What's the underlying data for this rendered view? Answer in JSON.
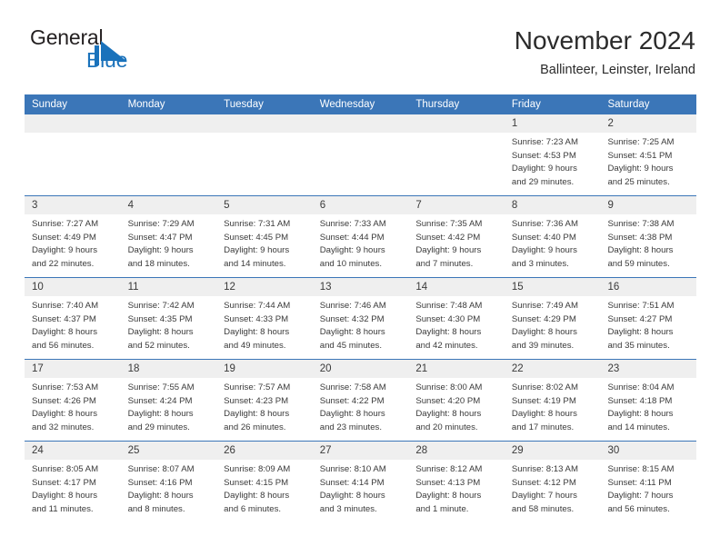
{
  "brand": {
    "name_top": "General",
    "name_bottom": "Blue",
    "logo_icon": "triangle-logo-icon",
    "accent_color": "#1a72bb"
  },
  "header": {
    "title": "November 2024",
    "subtitle": "Ballinteer, Leinster, Ireland"
  },
  "theme": {
    "header_blue": "#3b76b8",
    "cell_head_gray": "#efefef",
    "text_color": "#3a3a3a"
  },
  "calendar": {
    "weekday_headers": [
      "Sunday",
      "Monday",
      "Tuesday",
      "Wednesday",
      "Thursday",
      "Friday",
      "Saturday"
    ],
    "weeks": [
      [
        {
          "day": "",
          "lines": [],
          "empty": true
        },
        {
          "day": "",
          "lines": [],
          "empty": true
        },
        {
          "day": "",
          "lines": [],
          "empty": true
        },
        {
          "day": "",
          "lines": [],
          "empty": true
        },
        {
          "day": "",
          "lines": [],
          "empty": true
        },
        {
          "day": "1",
          "lines": [
            "Sunrise: 7:23 AM",
            "Sunset: 4:53 PM",
            "Daylight: 9 hours",
            "and 29 minutes."
          ],
          "empty": false
        },
        {
          "day": "2",
          "lines": [
            "Sunrise: 7:25 AM",
            "Sunset: 4:51 PM",
            "Daylight: 9 hours",
            "and 25 minutes."
          ],
          "empty": false
        }
      ],
      [
        {
          "day": "3",
          "lines": [
            "Sunrise: 7:27 AM",
            "Sunset: 4:49 PM",
            "Daylight: 9 hours",
            "and 22 minutes."
          ],
          "empty": false
        },
        {
          "day": "4",
          "lines": [
            "Sunrise: 7:29 AM",
            "Sunset: 4:47 PM",
            "Daylight: 9 hours",
            "and 18 minutes."
          ],
          "empty": false
        },
        {
          "day": "5",
          "lines": [
            "Sunrise: 7:31 AM",
            "Sunset: 4:45 PM",
            "Daylight: 9 hours",
            "and 14 minutes."
          ],
          "empty": false
        },
        {
          "day": "6",
          "lines": [
            "Sunrise: 7:33 AM",
            "Sunset: 4:44 PM",
            "Daylight: 9 hours",
            "and 10 minutes."
          ],
          "empty": false
        },
        {
          "day": "7",
          "lines": [
            "Sunrise: 7:35 AM",
            "Sunset: 4:42 PM",
            "Daylight: 9 hours",
            "and 7 minutes."
          ],
          "empty": false
        },
        {
          "day": "8",
          "lines": [
            "Sunrise: 7:36 AM",
            "Sunset: 4:40 PM",
            "Daylight: 9 hours",
            "and 3 minutes."
          ],
          "empty": false
        },
        {
          "day": "9",
          "lines": [
            "Sunrise: 7:38 AM",
            "Sunset: 4:38 PM",
            "Daylight: 8 hours",
            "and 59 minutes."
          ],
          "empty": false
        }
      ],
      [
        {
          "day": "10",
          "lines": [
            "Sunrise: 7:40 AM",
            "Sunset: 4:37 PM",
            "Daylight: 8 hours",
            "and 56 minutes."
          ],
          "empty": false
        },
        {
          "day": "11",
          "lines": [
            "Sunrise: 7:42 AM",
            "Sunset: 4:35 PM",
            "Daylight: 8 hours",
            "and 52 minutes."
          ],
          "empty": false
        },
        {
          "day": "12",
          "lines": [
            "Sunrise: 7:44 AM",
            "Sunset: 4:33 PM",
            "Daylight: 8 hours",
            "and 49 minutes."
          ],
          "empty": false
        },
        {
          "day": "13",
          "lines": [
            "Sunrise: 7:46 AM",
            "Sunset: 4:32 PM",
            "Daylight: 8 hours",
            "and 45 minutes."
          ],
          "empty": false
        },
        {
          "day": "14",
          "lines": [
            "Sunrise: 7:48 AM",
            "Sunset: 4:30 PM",
            "Daylight: 8 hours",
            "and 42 minutes."
          ],
          "empty": false
        },
        {
          "day": "15",
          "lines": [
            "Sunrise: 7:49 AM",
            "Sunset: 4:29 PM",
            "Daylight: 8 hours",
            "and 39 minutes."
          ],
          "empty": false
        },
        {
          "day": "16",
          "lines": [
            "Sunrise: 7:51 AM",
            "Sunset: 4:27 PM",
            "Daylight: 8 hours",
            "and 35 minutes."
          ],
          "empty": false
        }
      ],
      [
        {
          "day": "17",
          "lines": [
            "Sunrise: 7:53 AM",
            "Sunset: 4:26 PM",
            "Daylight: 8 hours",
            "and 32 minutes."
          ],
          "empty": false
        },
        {
          "day": "18",
          "lines": [
            "Sunrise: 7:55 AM",
            "Sunset: 4:24 PM",
            "Daylight: 8 hours",
            "and 29 minutes."
          ],
          "empty": false
        },
        {
          "day": "19",
          "lines": [
            "Sunrise: 7:57 AM",
            "Sunset: 4:23 PM",
            "Daylight: 8 hours",
            "and 26 minutes."
          ],
          "empty": false
        },
        {
          "day": "20",
          "lines": [
            "Sunrise: 7:58 AM",
            "Sunset: 4:22 PM",
            "Daylight: 8 hours",
            "and 23 minutes."
          ],
          "empty": false
        },
        {
          "day": "21",
          "lines": [
            "Sunrise: 8:00 AM",
            "Sunset: 4:20 PM",
            "Daylight: 8 hours",
            "and 20 minutes."
          ],
          "empty": false
        },
        {
          "day": "22",
          "lines": [
            "Sunrise: 8:02 AM",
            "Sunset: 4:19 PM",
            "Daylight: 8 hours",
            "and 17 minutes."
          ],
          "empty": false
        },
        {
          "day": "23",
          "lines": [
            "Sunrise: 8:04 AM",
            "Sunset: 4:18 PM",
            "Daylight: 8 hours",
            "and 14 minutes."
          ],
          "empty": false
        }
      ],
      [
        {
          "day": "24",
          "lines": [
            "Sunrise: 8:05 AM",
            "Sunset: 4:17 PM",
            "Daylight: 8 hours",
            "and 11 minutes."
          ],
          "empty": false
        },
        {
          "day": "25",
          "lines": [
            "Sunrise: 8:07 AM",
            "Sunset: 4:16 PM",
            "Daylight: 8 hours",
            "and 8 minutes."
          ],
          "empty": false
        },
        {
          "day": "26",
          "lines": [
            "Sunrise: 8:09 AM",
            "Sunset: 4:15 PM",
            "Daylight: 8 hours",
            "and 6 minutes."
          ],
          "empty": false
        },
        {
          "day": "27",
          "lines": [
            "Sunrise: 8:10 AM",
            "Sunset: 4:14 PM",
            "Daylight: 8 hours",
            "and 3 minutes."
          ],
          "empty": false
        },
        {
          "day": "28",
          "lines": [
            "Sunrise: 8:12 AM",
            "Sunset: 4:13 PM",
            "Daylight: 8 hours",
            "and 1 minute."
          ],
          "empty": false
        },
        {
          "day": "29",
          "lines": [
            "Sunrise: 8:13 AM",
            "Sunset: 4:12 PM",
            "Daylight: 7 hours",
            "and 58 minutes."
          ],
          "empty": false
        },
        {
          "day": "30",
          "lines": [
            "Sunrise: 8:15 AM",
            "Sunset: 4:11 PM",
            "Daylight: 7 hours",
            "and 56 minutes."
          ],
          "empty": false
        }
      ]
    ]
  }
}
